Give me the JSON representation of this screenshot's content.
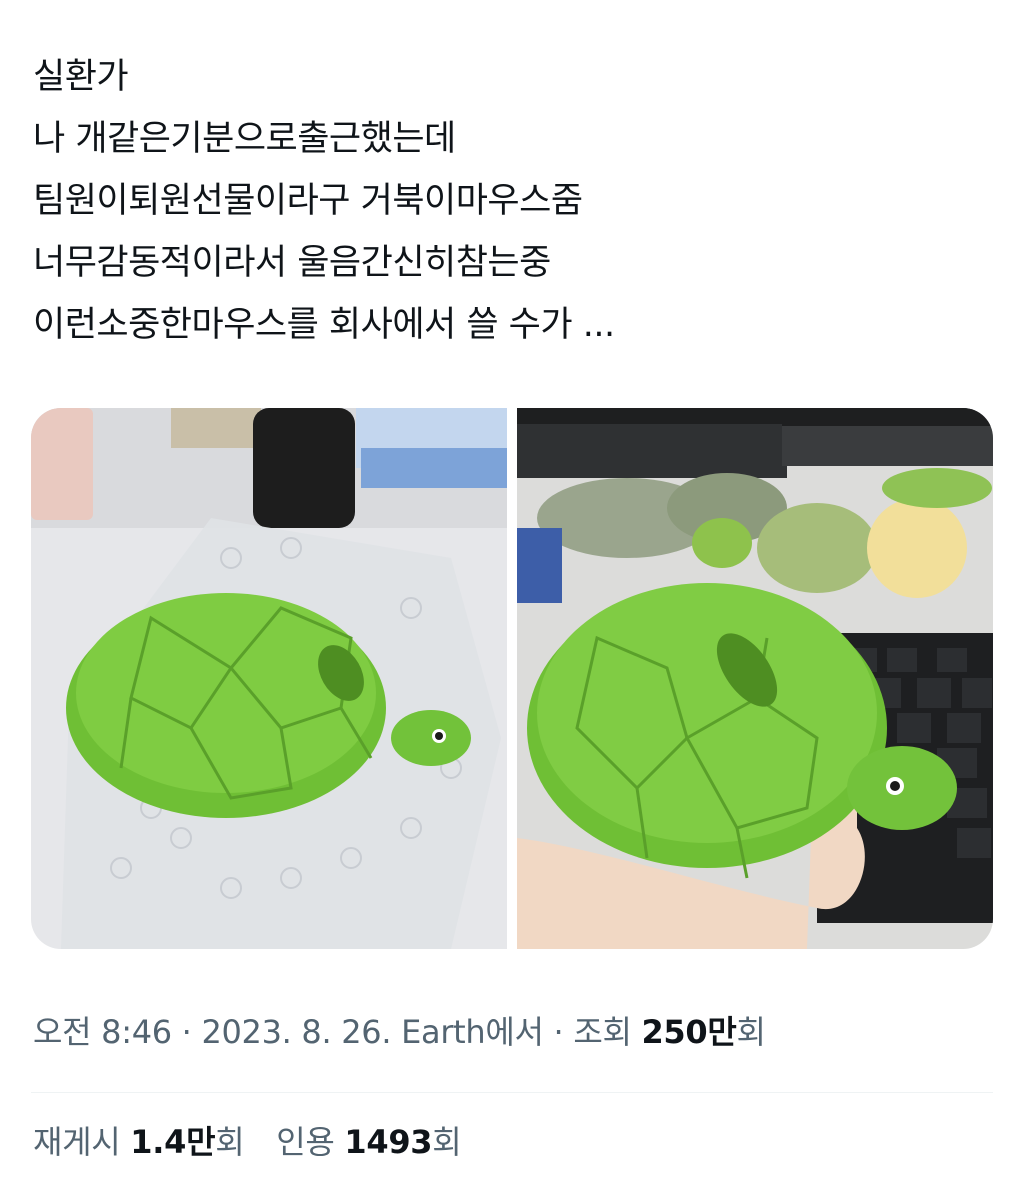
{
  "tweet": {
    "text_lines": [
      "실환가",
      "나 개같은기분으로출근했는데",
      "팀원이퇴원선물이라구 거북이마우스줌",
      "너무감동적이라서 울음간신히참는중",
      "이런소중한마우스를 회사에서 쓸 수가 ..."
    ]
  },
  "media": {
    "photos": [
      {
        "icon": "turtle-mouse-on-bubble-wrap-photo"
      },
      {
        "icon": "turtle-mouse-in-hand-photo"
      }
    ]
  },
  "meta": {
    "time": "오전 8:46",
    "sep1": " · ",
    "date": "2023. 8. 26.",
    "source": " Earth에서",
    "sep2": " · ",
    "views_label": "조회 ",
    "views_value": "250만",
    "views_suffix": "회"
  },
  "stats": {
    "retweets_label": "재게시 ",
    "retweets_value": "1.4만",
    "retweets_suffix": "회",
    "quotes_label": "인용 ",
    "quotes_value": "1493",
    "quotes_suffix": "회"
  },
  "colors": {
    "text_primary": "#0f1419",
    "text_secondary": "#536471",
    "divider": "#eff3f4",
    "turtle_green": "#78c83a"
  }
}
